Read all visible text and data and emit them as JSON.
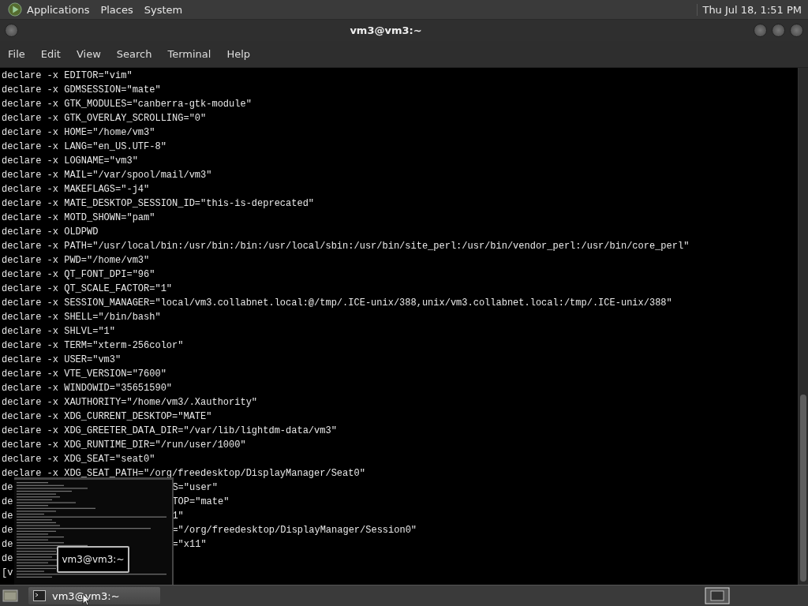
{
  "panel": {
    "menus": [
      "Applications",
      "Places",
      "System"
    ],
    "clock": "Thu Jul 18, 1:51 PM"
  },
  "window": {
    "title": "vm3@vm3:~",
    "menu": [
      "File",
      "Edit",
      "View",
      "Search",
      "Terminal",
      "Help"
    ]
  },
  "terminal": {
    "lines": [
      {
        "kind": "full",
        "text": "declare -x EDITOR=\"vim\""
      },
      {
        "kind": "full",
        "text": "declare -x GDMSESSION=\"mate\""
      },
      {
        "kind": "full",
        "text": "declare -x GTK_MODULES=\"canberra-gtk-module\""
      },
      {
        "kind": "full",
        "text": "declare -x GTK_OVERLAY_SCROLLING=\"0\""
      },
      {
        "kind": "full",
        "text": "declare -x HOME=\"/home/vm3\""
      },
      {
        "kind": "full",
        "text": "declare -x LANG=\"en_US.UTF-8\""
      },
      {
        "kind": "full",
        "text": "declare -x LOGNAME=\"vm3\""
      },
      {
        "kind": "full",
        "text": "declare -x MAIL=\"/var/spool/mail/vm3\""
      },
      {
        "kind": "full",
        "text": "declare -x MAKEFLAGS=\"-j4\""
      },
      {
        "kind": "full",
        "text": "declare -x MATE_DESKTOP_SESSION_ID=\"this-is-deprecated\""
      },
      {
        "kind": "full",
        "text": "declare -x MOTD_SHOWN=\"pam\""
      },
      {
        "kind": "full",
        "text": "declare -x OLDPWD"
      },
      {
        "kind": "full",
        "text": "declare -x PATH=\"/usr/local/bin:/usr/bin:/bin:/usr/local/sbin:/usr/bin/site_perl:/usr/bin/vendor_perl:/usr/bin/core_perl\""
      },
      {
        "kind": "full",
        "text": "declare -x PWD=\"/home/vm3\""
      },
      {
        "kind": "full",
        "text": "declare -x QT_FONT_DPI=\"96\""
      },
      {
        "kind": "full",
        "text": "declare -x QT_SCALE_FACTOR=\"1\""
      },
      {
        "kind": "full",
        "text": "declare -x SESSION_MANAGER=\"local/vm3.collabnet.local:@/tmp/.ICE-unix/388,unix/vm3.collabnet.local:/tmp/.ICE-unix/388\""
      },
      {
        "kind": "full",
        "text": "declare -x SHELL=\"/bin/bash\""
      },
      {
        "kind": "full",
        "text": "declare -x SHLVL=\"1\""
      },
      {
        "kind": "full",
        "text": "declare -x TERM=\"xterm-256color\""
      },
      {
        "kind": "full",
        "text": "declare -x USER=\"vm3\""
      },
      {
        "kind": "full",
        "text": "declare -x VTE_VERSION=\"7600\""
      },
      {
        "kind": "full",
        "text": "declare -x WINDOWID=\"35651590\""
      },
      {
        "kind": "full",
        "text": "declare -x XAUTHORITY=\"/home/vm3/.Xauthority\""
      },
      {
        "kind": "full",
        "text": "declare -x XDG_CURRENT_DESKTOP=\"MATE\""
      },
      {
        "kind": "full",
        "text": "declare -x XDG_GREETER_DATA_DIR=\"/var/lib/lightdm-data/vm3\""
      },
      {
        "kind": "full",
        "text": "declare -x XDG_RUNTIME_DIR=\"/run/user/1000\""
      },
      {
        "kind": "full",
        "text": "declare -x XDG_SEAT=\"seat0\""
      },
      {
        "kind": "full",
        "text": "declare -x XDG_SEAT_PATH=\"/org/freedesktop/DisplayManager/Seat0\""
      },
      {
        "kind": "covered",
        "left": "de",
        "right": "S=\"user\""
      },
      {
        "kind": "covered",
        "left": "de",
        "right": "TOP=\"mate\""
      },
      {
        "kind": "covered",
        "left": "de",
        "right": "1\""
      },
      {
        "kind": "covered",
        "left": "de",
        "right": "=\"/org/freedesktop/DisplayManager/Session0\""
      },
      {
        "kind": "covered",
        "left": "de",
        "right": "=\"x11\""
      },
      {
        "kind": "covered",
        "left": "de"
      },
      {
        "kind": "covered",
        "left": "[v"
      }
    ]
  },
  "switcher": {
    "title": "vm3@vm3:~"
  },
  "taskbar": {
    "tasks": [
      {
        "label": "vm3@vm3:~",
        "selected": true
      }
    ]
  }
}
